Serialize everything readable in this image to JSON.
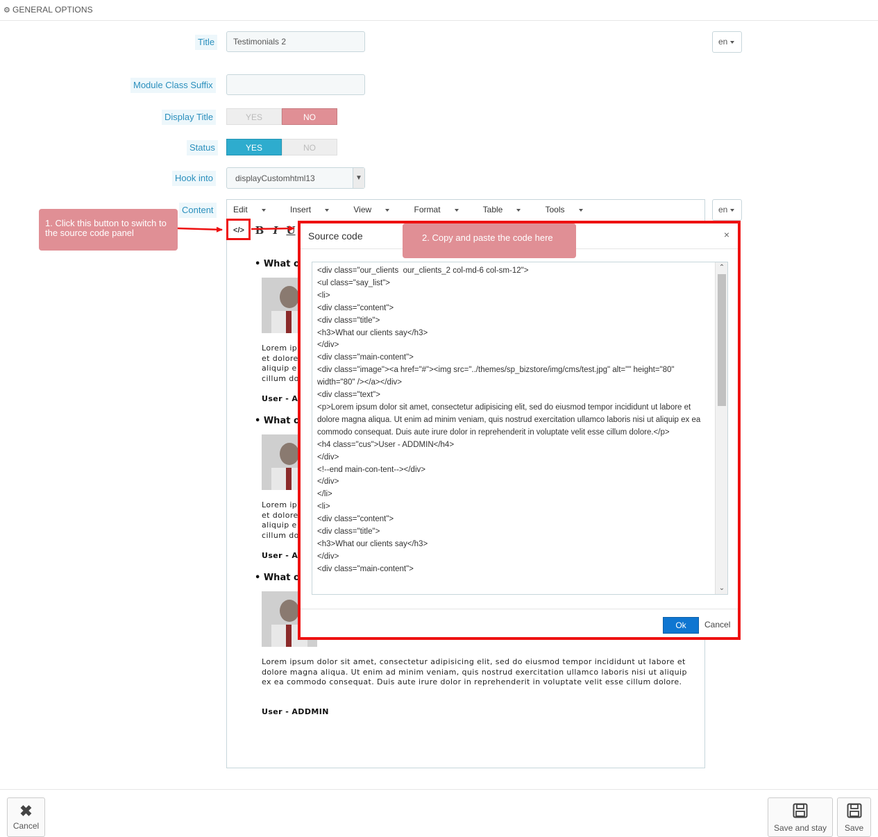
{
  "panel": {
    "icon": "cogs-icon",
    "title": "GENERAL OPTIONS"
  },
  "form": {
    "title_label": "Title",
    "title_value": "Testimonials 2",
    "lang": "en",
    "suffix_label": "Module Class Suffix",
    "suffix_value": "",
    "display_title_label": "Display Title",
    "display_title": {
      "yes": "YES",
      "no": "NO",
      "selected": "NO"
    },
    "status_label": "Status",
    "status": {
      "yes": "YES",
      "no": "NO",
      "selected": "YES"
    },
    "hook_label": "Hook into",
    "hook_value": "displayCustomhtml13",
    "content_label": "Content"
  },
  "editor": {
    "menus": [
      "Edit",
      "Insert",
      "View",
      "Format",
      "Table",
      "Tools"
    ],
    "toolbar": {
      "source": "</>",
      "bold": "B",
      "italic": "I",
      "underline": "U"
    },
    "testimonial_heading_fragment": "What o",
    "lorem_full": "Lorem ipsum dolor sit amet, consectetur adipisicing elit, sed do eiusmod tempor incididunt ut labore et dolore magna aliqua. Ut enim ad minim veniam, quis nostrud exercitation ullamco laboris nisi ut aliquip ex ea commodo consequat. Duis aute irure dolor in reprehenderit in voluptate velit esse cillum dolore.",
    "lorem_lines_cut": [
      "Lorem ip",
      "et dolore",
      "aliquip e",
      "cillum do"
    ],
    "user_cut": "User - A",
    "user_full": "User - ADDMIN"
  },
  "callouts": {
    "step1": "1. Click this button to switch to the source code panel",
    "step2": "2. Copy and paste the code here"
  },
  "modal": {
    "title": "Source code",
    "close": "×",
    "code_lines": [
      "<div class=\"our_clients  our_clients_2 col-md-6 col-sm-12\">",
      "<ul class=\"say_list\">",
      "<li>",
      "<div class=\"content\">",
      "<div class=\"title\">",
      "<h3>What our clients say</h3>",
      "</div>",
      "<div class=\"main-content\">",
      "<div class=\"image\"><a href=\"#\"><img src=\"../themes/sp_bizstore/img/cms/test.jpg\" alt=\"\" height=\"80\" width=\"80\" /></a></div>",
      "<div class=\"text\">",
      "<p>Lorem ipsum dolor sit amet, consectetur adipisicing elit, sed do eiusmod tempor incididunt ut labore et dolore magna aliqua. Ut enim ad minim veniam, quis nostrud exercitation ullamco laboris nisi ut aliquip ex ea commodo consequat. Duis aute irure dolor in reprehenderit in voluptate velit esse cillum dolore.</p>",
      "<h4 class=\"cus\">User - ADDMIN</h4>",
      "</div>",
      "<!--end main-con-tent--></div>",
      "</div>",
      "</li>",
      "<li>",
      "<div class=\"content\">",
      "<div class=\"title\">",
      "<h3>What our clients say</h3>",
      "</div>",
      "<div class=\"main-content\">"
    ],
    "ok": "Ok",
    "cancel": "Cancel"
  },
  "footer": {
    "cancel": "Cancel",
    "save_and_stay": "Save and stay",
    "save": "Save"
  }
}
